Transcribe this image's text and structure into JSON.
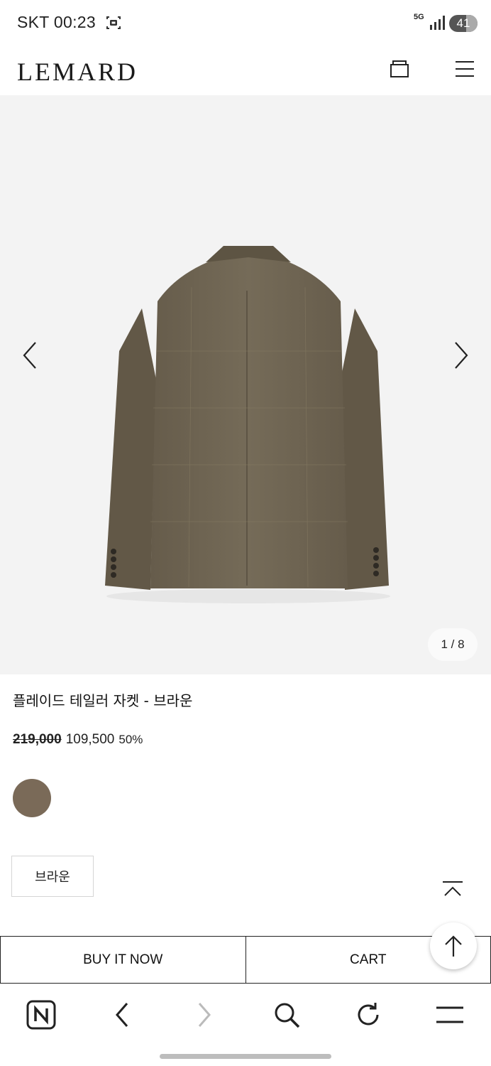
{
  "status_bar": {
    "carrier_time": "SKT 00:23",
    "network": "5G",
    "battery": "41"
  },
  "header": {
    "logo": "LEMARD",
    "icons": [
      "bag-icon",
      "menu-icon"
    ]
  },
  "gallery": {
    "counter": "1 / 8",
    "background": "#f3f3f3",
    "jacket_color": "#6f6553"
  },
  "product": {
    "title": "플레이드 테일러 자켓 - 브라운",
    "original_price": "219,000",
    "sale_price": "109,500",
    "discount": "50%",
    "swatch_color": "#7a6a58",
    "selected_option": "브라운"
  },
  "actions": {
    "buy_now": "BUY IT NOW",
    "cart": "CART"
  },
  "browser_nav": {
    "icons": [
      "naver-home-icon",
      "back-icon",
      "forward-icon",
      "search-icon",
      "refresh-icon",
      "menu-icon"
    ]
  }
}
